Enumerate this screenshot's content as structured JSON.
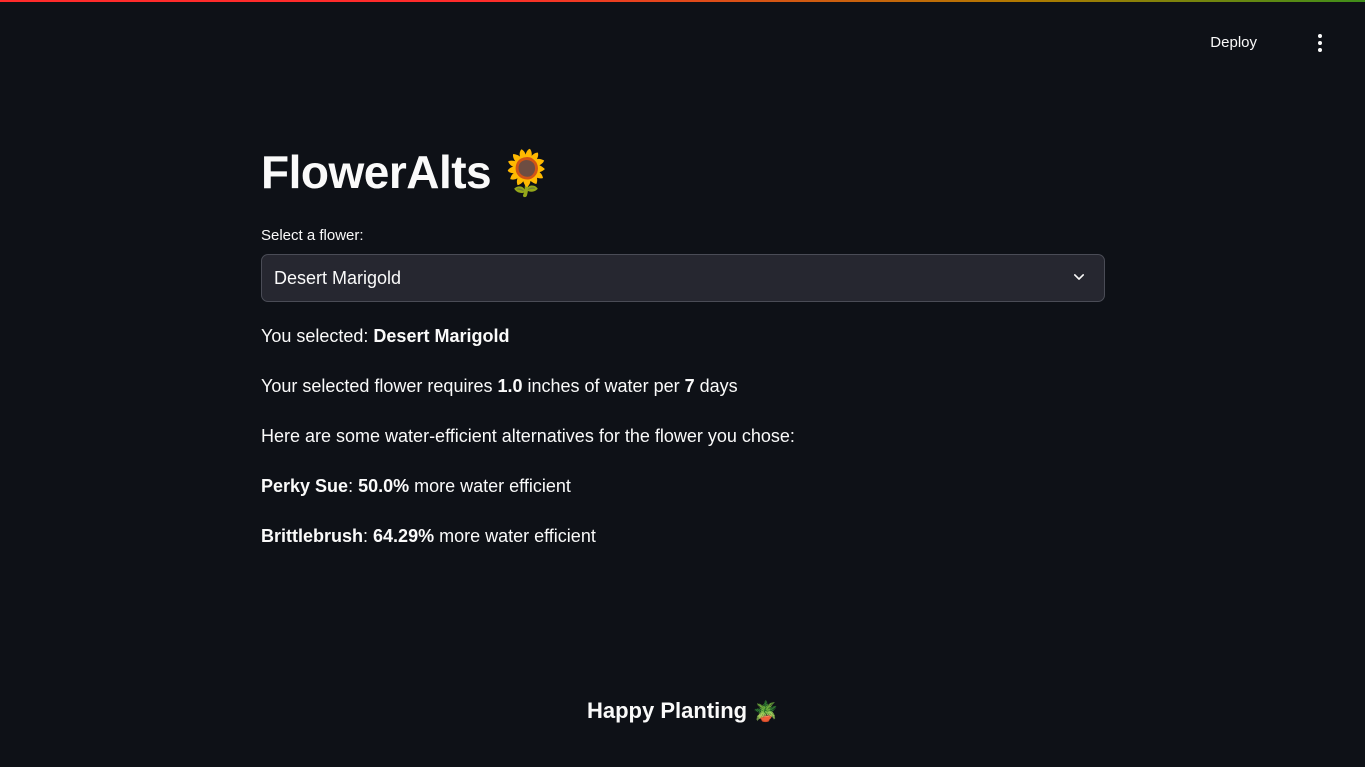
{
  "header": {
    "deploy_label": "Deploy",
    "menu_icon": "vertical-ellipsis-icon"
  },
  "main": {
    "title": "FlowerAlts",
    "title_emoji": "🌻",
    "select": {
      "label": "Select a flower:",
      "value": "Desert Marigold",
      "icon": "chevron-down-icon"
    },
    "selected_prefix": "You selected: ",
    "selected_value": "Desert Marigold",
    "water_prefix": "Your selected flower requires ",
    "water_amount": "1.0",
    "water_middle": " inches of water per ",
    "water_days": "7",
    "water_suffix": " days",
    "alternatives_intro": "Here are some water-efficient alternatives for the flower you chose:",
    "alternatives": [
      {
        "name": "Perky Sue",
        "sep": ": ",
        "percent": "50.0%",
        "suffix": " more water efficient"
      },
      {
        "name": "Brittlebrush",
        "sep": ": ",
        "percent": "64.29%",
        "suffix": " more water efficient"
      }
    ]
  },
  "footer": {
    "text": "Happy Planting",
    "emoji": "🪴"
  },
  "colors": {
    "background": "#0e1117",
    "text": "#fafafa",
    "select_bg": "#262730",
    "accent_red": "#ff2b2b"
  }
}
